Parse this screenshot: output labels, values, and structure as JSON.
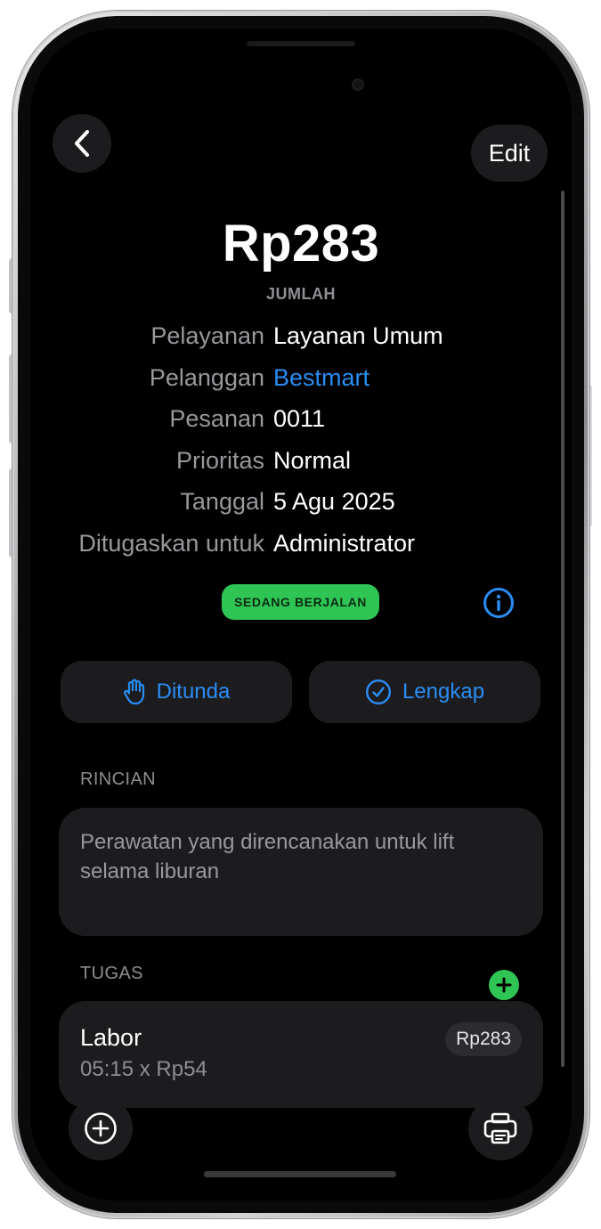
{
  "header": {
    "back_icon": "chevron-left-icon",
    "edit_label": "Edit"
  },
  "amount": {
    "value": "Rp283",
    "label": "JUMLAH"
  },
  "info": [
    {
      "key": "Pelayanan",
      "value": "Layanan Umum",
      "link": false
    },
    {
      "key": "Pelanggan",
      "value": "Bestmart",
      "link": true
    },
    {
      "key": "Pesanan",
      "value": "0011",
      "link": false
    },
    {
      "key": "Prioritas",
      "value": "Normal",
      "link": false
    },
    {
      "key": "Tanggal",
      "value": "5 Agu 2025",
      "link": false
    },
    {
      "key": "Ditugaskan untuk",
      "value": "Administrator",
      "link": false
    }
  ],
  "status": {
    "label": "SEDANG BERJALAN",
    "color": "#2fc555"
  },
  "actions": {
    "hold_label": "Ditunda",
    "complete_label": "Lengkap"
  },
  "details": {
    "section_label": "RINCIAN",
    "text": "Perawatan yang direncanakan untuk lift selama liburan"
  },
  "tasks": {
    "section_label": "TUGAS",
    "items": [
      {
        "name": "Labor",
        "detail": "05:15 x Rp54",
        "price": "Rp283"
      }
    ]
  },
  "colors": {
    "accent": "#2a8df5",
    "success": "#2fc555",
    "card": "#1c1c1e",
    "background": "#000000"
  }
}
